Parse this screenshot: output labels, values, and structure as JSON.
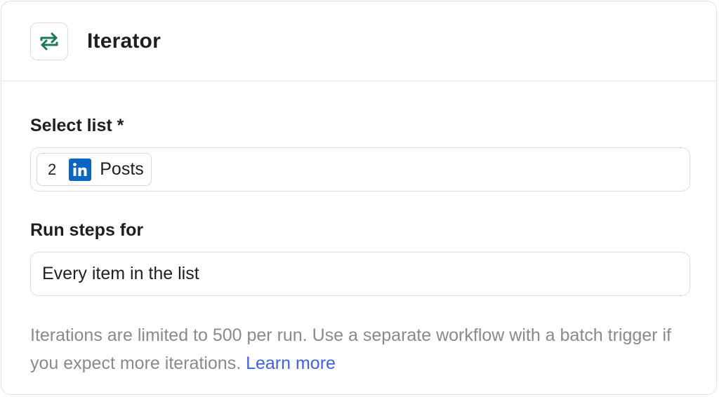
{
  "header": {
    "title": "Iterator",
    "icon": "repeat-arrows-icon",
    "icon_color": "#1b7a53"
  },
  "select_list": {
    "label": "Select list *",
    "chip": {
      "count": "2",
      "app_icon": "linkedin-icon",
      "app_icon_color": "#0a66c2",
      "label": "Posts"
    }
  },
  "run_steps_for": {
    "label": "Run steps for",
    "value": "Every item in the list"
  },
  "help": {
    "text": "Iterations are limited to 500 per run. Use a separate workflow with a batch trigger if you expect more iterations. ",
    "link_label": "Learn more",
    "link_color": "#3e63e6"
  }
}
